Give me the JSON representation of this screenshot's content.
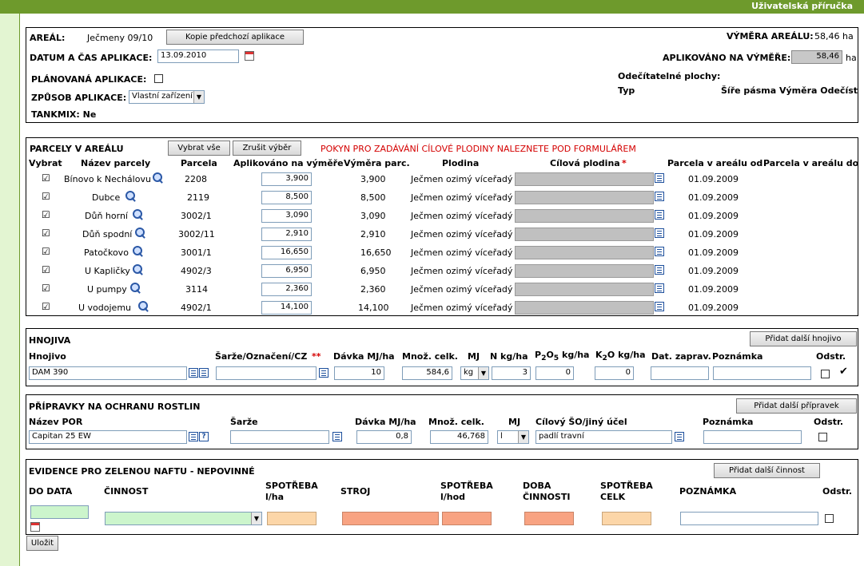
{
  "topbar": {
    "help_link": "Uživatelská příručka"
  },
  "areal": {
    "areal_label": "AREÁL:",
    "areal_value": "Ječmeny 09/10",
    "copy_button": "Kopie předchozí aplikace",
    "vymera_label": "VÝMĚRA AREÁLU:",
    "vymera_value": "58,46 ha",
    "datum_label": "DATUM A ČAS APLIKACE:",
    "datum_value": "13.09.2010",
    "aplikovano_label": "APLIKOVÁNO NA VÝMĚŘE:",
    "aplikovano_value": "58,46",
    "aplikovano_unit": "ha",
    "planovana_label": "PLÁNOVANÁ APLIKACE:",
    "zpusob_label": "ZPŮSOB APLIKACE:",
    "zpusob_value": "Vlastní zařízení",
    "tankmix_label": "TANKMIX: Ne",
    "odecitatelne_label": "Odečítatelné plochy:",
    "typ_label": "Typ",
    "odecitatelne_cols": "Šíře pásma Výměra Odečíst"
  },
  "parcely": {
    "title": "PARCELY V AREÁLU",
    "select_all": "Vybrat vše",
    "deselect": "Zrušit výběr",
    "hint": "POKYN PRO ZADÁVÁNÍ CÍLOVÉ PLODINY NALEZNETE POD FORMULÁŘEM",
    "columns": {
      "vybrat": "Vybrat",
      "nazev": "Název parcely",
      "parcela": "Parcela",
      "aplikovano": "Aplikováno na výměře",
      "vymera": "Výměra parc.",
      "plodina": "Plodina",
      "cilova": "Cílová plodina",
      "cilova_star": "*",
      "od": "Parcela v areálu od",
      "do": "Parcela v areálu do"
    },
    "rows": [
      {
        "check": "☑",
        "name": "Bínovo k Nechálovu",
        "parcel": "2208",
        "applied": "3,900",
        "area": "3,900",
        "crop": "Ječmen ozimý víceřadý",
        "from": "01.09.2009"
      },
      {
        "check": "☑",
        "name": "Dubce",
        "parcel": "2119",
        "applied": "8,500",
        "area": "8,500",
        "crop": "Ječmen ozimý víceřadý",
        "from": "01.09.2009"
      },
      {
        "check": "☑",
        "name": "Důň horní",
        "parcel": "3002/1",
        "applied": "3,090",
        "area": "3,090",
        "crop": "Ječmen ozimý víceřadý",
        "from": "01.09.2009"
      },
      {
        "check": "☑",
        "name": "Důň spodní",
        "parcel": "3002/11",
        "applied": "2,910",
        "area": "2,910",
        "crop": "Ječmen ozimý víceřadý",
        "from": "01.09.2009"
      },
      {
        "check": "☑",
        "name": "Patočkovo",
        "parcel": "3001/1",
        "applied": "16,650",
        "area": "16,650",
        "crop": "Ječmen ozimý víceřadý",
        "from": "01.09.2009"
      },
      {
        "check": "☑",
        "name": "U Kapličky",
        "parcel": "4902/3",
        "applied": "6,950",
        "area": "6,950",
        "crop": "Ječmen ozimý víceřadý",
        "from": "01.09.2009"
      },
      {
        "check": "☑",
        "name": "U pumpy",
        "parcel": "3114",
        "applied": "2,360",
        "area": "2,360",
        "crop": "Ječmen ozimý víceřadý",
        "from": "01.09.2009"
      },
      {
        "check": "☑",
        "name": "U vodojemu",
        "parcel": "4902/1",
        "applied": "14,100",
        "area": "14,100",
        "crop": "Ječmen ozimý víceřadý",
        "from": "01.09.2009"
      }
    ]
  },
  "hnojiva": {
    "title": "HNOJIVA",
    "add_button": "Přidat další hnojivo",
    "col_hnojivo": "Hnojivo",
    "col_sarze": "Šarže/Označení/CZ",
    "col_sarze_star": "**",
    "col_davka": "Dávka MJ/ha",
    "col_mnoz": "Množ. celk.",
    "col_mj": "MJ",
    "col_n": "N kg/ha",
    "col_p_a": "P",
    "col_p_sub1": "2",
    "col_p_b": "O",
    "col_p_sub2": "5",
    "col_p_c": "kg/ha",
    "col_k_a": "K",
    "col_k_sub": "2",
    "col_k_b": "O kg/ha",
    "col_dat": "Dat. zaprav.",
    "col_pozn": "Poznámka",
    "col_odstr": "Odstr.",
    "row": {
      "hnojivo": "DAM 390",
      "davka": "10",
      "mnoz": "584,6",
      "mj": "kg",
      "n": "3",
      "p": "0",
      "k": "0",
      "check": "✔"
    }
  },
  "por": {
    "title": "PŘÍPRAVKY NA OCHRANU ROSTLIN",
    "add_button": "Přidat další přípravek",
    "col_nazev": "Název POR",
    "col_sarze": "Šarže",
    "col_davka": "Dávka MJ/ha",
    "col_mnoz": "Množ. celk.",
    "col_mj": "MJ",
    "col_cil": "Cílový ŠO/jiný účel",
    "col_pozn": "Poznámka",
    "col_odstr": "Odstr.",
    "row": {
      "nazev": "Capitan 25 EW",
      "davka": "0,8",
      "mnoz": "46,768",
      "mj": "l",
      "cil": "padlí travní"
    }
  },
  "nafta": {
    "title": "EVIDENCE PRO ZELENOU NAFTU - NEPOVINNÉ",
    "add_button": "Přidat další činnost",
    "col_do_data": "DO DATA",
    "col_cinnost": "ČINNOST",
    "col_spotreba_ha_1": "SPOTŘEBA",
    "col_spotreba_ha_2": "l/ha",
    "col_stroj": "STROJ",
    "col_spotreba_hod_1": "SPOTŘEBA",
    "col_spotreba_hod_2": "l/hod",
    "col_doba_1": "DOBA",
    "col_doba_2": "ČINNOSTI",
    "col_spotreba_celk_1": "SPOTŘEBA",
    "col_spotreba_celk_2": "CELK",
    "col_pozn": "POZNÁMKA",
    "col_odstr": "Odstr."
  },
  "save_button": "Uložit"
}
